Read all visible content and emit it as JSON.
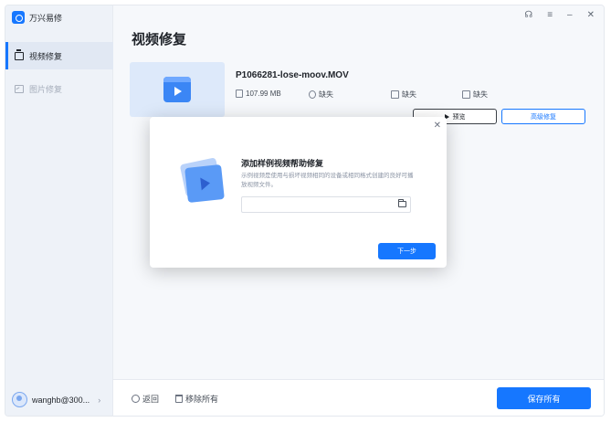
{
  "app": {
    "name": "万兴易修"
  },
  "sidebar": {
    "items": [
      {
        "label": "视频修复",
        "icon": "video-icon",
        "active": true
      },
      {
        "label": "图片修复",
        "icon": "photo-icon",
        "active": false
      }
    ],
    "user": {
      "name": "wanghb@300..."
    }
  },
  "window": {
    "controls": [
      "headset-icon",
      "menu-icon",
      "minimize-icon",
      "close-icon"
    ]
  },
  "main": {
    "title": "视频修复",
    "file": {
      "name": "P1066281-lose-moov.MOV",
      "size": "107.99 MB",
      "duration": "缺失",
      "resolution": "缺失",
      "codec": "缺失",
      "preview_label": "预览",
      "advanced_label": "高级修复"
    }
  },
  "modal": {
    "title": "添加样例视频帮助修复",
    "description": "示例视频是使用与损坏视频相同的设备或相同格式创建的良好可播放视频文件。",
    "path_value": "",
    "next_label": "下一步"
  },
  "footer": {
    "back_label": "返回",
    "remove_all_label": "移除所有",
    "save_all_label": "保存所有"
  },
  "colors": {
    "accent": "#1677ff"
  }
}
